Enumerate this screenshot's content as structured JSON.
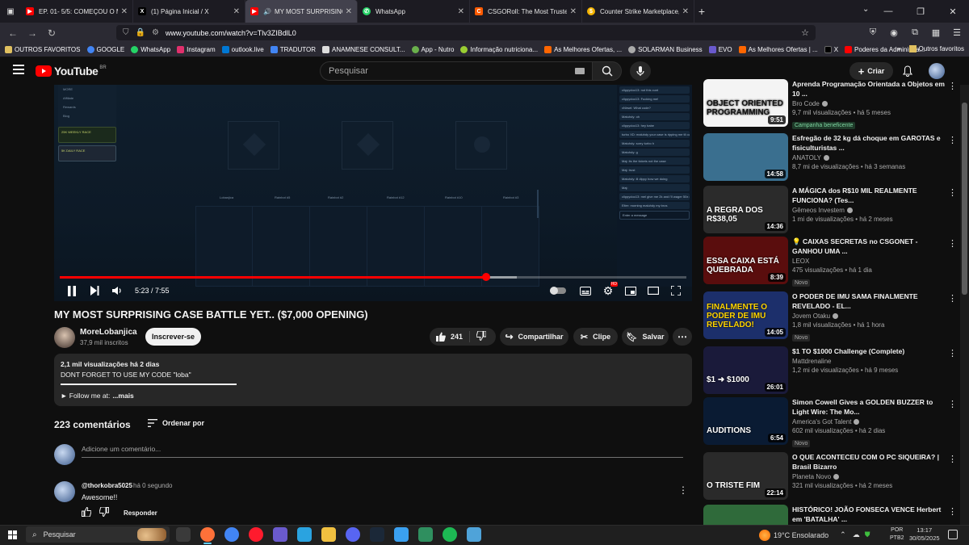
{
  "browser": {
    "tabs": [
      {
        "title": "EP. 01- 5/5: COMEÇOU O MASTER",
        "favicon_color": "#ff0000",
        "favicon": "youtube-icon"
      },
      {
        "title": "(1) Página Inicial / X",
        "favicon_color": "#000000",
        "favicon": "x-icon"
      },
      {
        "title": "MY MOST SURPRISING CASE BATTLE",
        "favicon_color": "#ff0000",
        "favicon": "youtube-icon",
        "active": true
      },
      {
        "title": "WhatsApp",
        "favicon_color": "#25d366",
        "favicon": "whatsapp-icon"
      },
      {
        "title": "CSGORoll: The Most Trusted & Fa",
        "favicon_color": "#ff5a00",
        "favicon": "csgoroll-icon"
      },
      {
        "title": "Counter Strike Marketplace, Buy",
        "favicon_color": "#f4b400",
        "favicon": "marketplace-icon"
      }
    ],
    "url": "www.youtube.com/watch?v=Tlv3ZIBdlL0",
    "bookmarks": [
      {
        "label": "OUTROS FAVORITOS",
        "color": "#e0c060"
      },
      {
        "label": "GOOGLE",
        "color": "#4285f4"
      },
      {
        "label": "WhatsApp",
        "color": "#25d366"
      },
      {
        "label": "Instagram",
        "color": "#e1306c"
      },
      {
        "label": "outlook.live",
        "color": "#0078d4"
      },
      {
        "label": "TRADUTOR",
        "color": "#4285f4"
      },
      {
        "label": "ANAMNESE CONSULT...",
        "color": "#dddddd"
      },
      {
        "label": "App - Nutro",
        "color": "#6ab04c"
      },
      {
        "label": "Informação nutriciona...",
        "color": "#9acd32"
      },
      {
        "label": "As Melhores Ofertas, ...",
        "color": "#ff6600"
      },
      {
        "label": "SOLARMAN Business",
        "color": "#aaaaaa"
      },
      {
        "label": "EVO",
        "color": "#6a5acd"
      },
      {
        "label": "As Melhores Ofertas | ...",
        "color": "#ff6600"
      },
      {
        "label": "X",
        "color": "#000000"
      },
      {
        "label": "Poderes da Administra...",
        "color": "#ff0000"
      }
    ],
    "bookmarks_other": "Outros favoritos"
  },
  "youtube": {
    "logo": "YouTube",
    "region": "BR",
    "search_placeholder": "Pesquisar",
    "create_label": "Criar"
  },
  "player": {
    "time": "5:23 / 7:55",
    "progress_fraction": 0.68,
    "buffer_fraction": 0.73,
    "hd_badge": "HD",
    "sidebar_rows": [
      "MORE",
      "Affiliate",
      "Rewards",
      "Blog"
    ],
    "race_1": "25K WEEKLY RACE",
    "race_2": "5K DAILY RACE",
    "players": [
      "Lobanjica",
      "Rainbot #5",
      "Rainbot #2",
      "Rainbot #12",
      "Rainbot #10",
      "Rainbot #3"
    ],
    "chat": [
      "clippydoo13: not this cunt",
      "clippydoo13: Fucking me!",
      "xNirsel: What code?",
      "Matuhdy: oh",
      "clippydoo13: hey babe",
      "turbo XD: maluhdy your case is ripping me til out",
      "Matuhdy: sorry turbo h",
      "Matuhdy: g",
      "Maj: its the tickets not the case",
      "Maj: trust",
      "Matuhdy: ill dippy how we doing",
      "Maj:",
      "clippydoo13: mel give me 2k and i'll wager 50x on your board",
      "Elter: morning maluhdy my bros"
    ],
    "chat_input": "Enter a message"
  },
  "video": {
    "title": "MY MOST SURPRISING CASE BATTLE YET.. ($7,000 OPENING)",
    "channel": "MoreLobanjica",
    "subscribers": "37,9 mil inscritos",
    "subscribe_label": "Inscrever-se",
    "likes": "241",
    "share_label": "Compartilhar",
    "clip_label": "Clipe",
    "save_label": "Salvar"
  },
  "description": {
    "stats": "2,1 mil visualizações  há 2 dias",
    "line1": "DONT FORGET TO USE MY CODE \"loba\"",
    "follow": "► Follow me at:",
    "more": "...mais"
  },
  "comments": {
    "count": "223 comentários",
    "sort_label": "Ordenar por",
    "add_placeholder": "Adicione um comentário...",
    "items": [
      {
        "author": "@thorkobra5025",
        "time": "há 0 segundo",
        "text": "Awesome!!",
        "reply_label": "Responder"
      }
    ]
  },
  "recommendations": [
    {
      "title": "Aprenda Programação Orientada a Objetos em 10 ...",
      "channel": "Bro Code",
      "verified": true,
      "meta": "9,7 mil visualizações • há 5 meses",
      "badge": "Campanha beneficente",
      "badge_type": "green",
      "duration": "9:51",
      "thumb_text": "OBJECT ORIENTED PROGRAMMING",
      "thumb_bg": "#f4f4f4",
      "thumb_fg": "#111111"
    },
    {
      "title": "Esfregão de 32 kg dá choque em GAROTAS e fisiculturistas ...",
      "channel": "ANATOLY",
      "verified": true,
      "meta": "8,7 mi de visualizações • há 3 semanas",
      "badge": "",
      "duration": "14:58",
      "thumb_text": "",
      "thumb_bg": "#3a6f8f",
      "thumb_fg": "#ffffff"
    },
    {
      "title": "A MÁGICA dos R$10 MIL REALMENTE FUNCIONA? (Tes...",
      "channel": "Gêmeos Investem",
      "verified": true,
      "meta": "1 mi de visualizações • há 2 meses",
      "badge": "",
      "duration": "14:36",
      "thumb_text": "A REGRA DOS R$38,05",
      "thumb_bg": "#2b2b2b",
      "thumb_fg": "#ffffff"
    },
    {
      "title": "💡 CAIXAS SECRETAS no CSGONET - GANHOU UMA ...",
      "channel": "LEOX",
      "verified": false,
      "meta": "475 visualizações • há 1 dia",
      "badge": "Novo",
      "badge_type": "gray",
      "duration": "8:39",
      "thumb_text": "ESSA CAIXA ESTÁ QUEBRADA",
      "thumb_bg": "#5a0d0d",
      "thumb_fg": "#ffffff"
    },
    {
      "title": "O PODER DE IMU SAMA FINALMENTE REVELADO - EL...",
      "channel": "Jovem Otaku",
      "verified": true,
      "meta": "1,8 mil visualizações • há 1 hora",
      "badge": "Novo",
      "badge_type": "gray",
      "duration": "14:05",
      "thumb_text": "FINALMENTE O PODER DE IMU REVELADO!",
      "thumb_bg": "#1c2f6b",
      "thumb_fg": "#ffd400"
    },
    {
      "title": "$1 TO $1000 Challenge (Complete)",
      "channel": "Mattdrenaline",
      "verified": false,
      "meta": "1,2 mi de visualizações • há 9 meses",
      "badge": "",
      "duration": "26:01",
      "thumb_text": "$1 ➜ $1000",
      "thumb_bg": "#1a1a3a",
      "thumb_fg": "#ffffff"
    },
    {
      "title": "Simon Cowell Gives a GOLDEN BUZZER to Light Wire: The Mo...",
      "channel": "America's Got Talent",
      "verified": true,
      "meta": "602 mil visualizações • há 2 dias",
      "badge": "Novo",
      "badge_type": "gray",
      "duration": "6:54",
      "thumb_text": "AUDITIONS",
      "thumb_bg": "#0a1b33",
      "thumb_fg": "#ffffff"
    },
    {
      "title": "O QUE ACONTECEU COM O PC SIQUEIRA? | Brasil Bizarro",
      "channel": "Planeta Novo",
      "verified": true,
      "meta": "321 mil visualizações • há 2 meses",
      "badge": "",
      "duration": "22:14",
      "thumb_text": "O TRISTE FIM",
      "thumb_bg": "#2a2a2a",
      "thumb_fg": "#ffffff"
    },
    {
      "title": "HISTÓRICO! JOÃO FONSECA VENCE Herbert em 'BATALHA' ...",
      "channel": "",
      "verified": false,
      "meta": "",
      "badge": "",
      "duration": "",
      "thumb_text": "",
      "thumb_bg": "#2f6a3a",
      "thumb_fg": "#ffffff"
    }
  ],
  "taskbar": {
    "search_placeholder": "Pesquisar",
    "apps": [
      {
        "name": "task-view-icon",
        "color": "#3a3a3a"
      },
      {
        "name": "firefox-icon",
        "color": "#ff7139"
      },
      {
        "name": "chrome-icon",
        "color": "#4285f4"
      },
      {
        "name": "opera-icon",
        "color": "#ff1b2d"
      },
      {
        "name": "app-icon",
        "color": "#6a5acd"
      },
      {
        "name": "telegram-icon",
        "color": "#2aa3e0"
      },
      {
        "name": "file-explorer-icon",
        "color": "#f0c040"
      },
      {
        "name": "discord-icon",
        "color": "#5865f2"
      },
      {
        "name": "steam-icon",
        "color": "#1b2838"
      },
      {
        "name": "app2-icon",
        "color": "#3aa0f0"
      },
      {
        "name": "app3-icon",
        "color": "#2f8f5f"
      },
      {
        "name": "spotify-icon",
        "color": "#1db954"
      },
      {
        "name": "notes-icon",
        "color": "#4fa3d9"
      }
    ],
    "weather": "19°C  Ensolarado",
    "lang": "POR",
    "lang2": "PTB2",
    "time": "13:17",
    "date": "30/05/2025"
  }
}
